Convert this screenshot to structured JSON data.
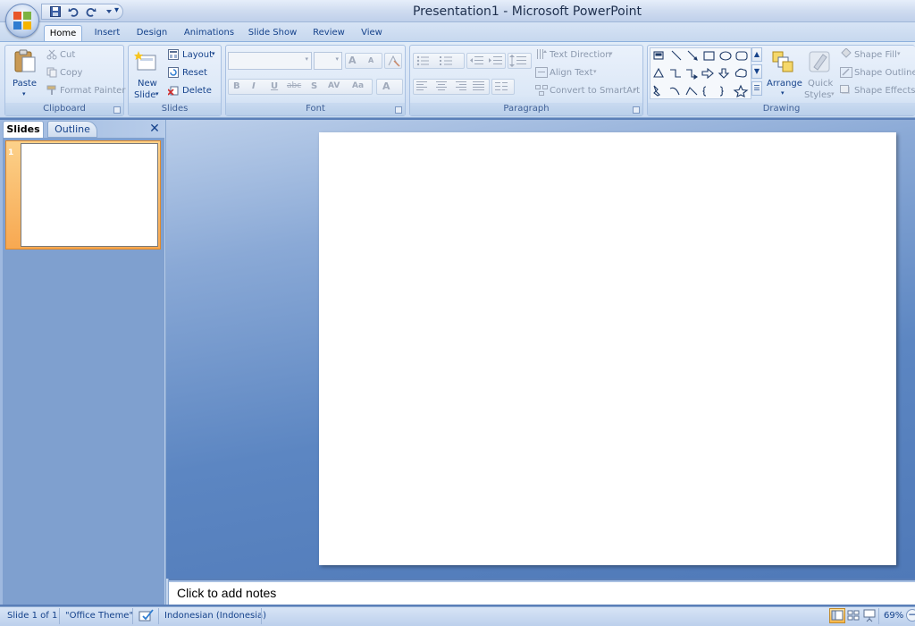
{
  "window": {
    "title": "Presentation1 - Microsoft PowerPoint"
  },
  "qat": {
    "save_icon": "save-icon",
    "undo_icon": "undo-icon",
    "redo_icon": "redo-icon",
    "customize_glyph": "▾"
  },
  "ribbon": {
    "tabs": [
      {
        "label": "Home",
        "active": true
      },
      {
        "label": "Insert"
      },
      {
        "label": "Design"
      },
      {
        "label": "Animations"
      },
      {
        "label": "Slide Show"
      },
      {
        "label": "Review"
      },
      {
        "label": "View"
      }
    ],
    "clipboard": {
      "paste": "Paste",
      "cut": "Cut",
      "copy": "Copy",
      "format_painter": "Format Painter",
      "group_label": "Clipboard"
    },
    "slides": {
      "new_slide_line1": "New",
      "new_slide_line2": "Slide",
      "layout": "Layout",
      "reset": "Reset",
      "delete": "Delete",
      "group_label": "Slides"
    },
    "font": {
      "group_label": "Font",
      "bold": "B",
      "italic": "I",
      "underline": "U",
      "strike": "abc",
      "shadow": "S",
      "spacing": "AV",
      "case": "Aa",
      "color": "A",
      "grow": "A",
      "shrink": "A"
    },
    "paragraph": {
      "group_label": "Paragraph",
      "text_direction": "Text Direction",
      "align_text": "Align Text",
      "convert_smartart": "Convert to SmartArt"
    },
    "drawing": {
      "group_label": "Drawing",
      "arrange": "Arrange",
      "quick_styles_line1": "Quick",
      "quick_styles_line2": "Styles",
      "shape_fill": "Shape Fill",
      "shape_outline": "Shape Outline",
      "shape_effects": "Shape Effects"
    }
  },
  "panel": {
    "tab_slides": "Slides",
    "tab_outline": "Outline",
    "close_glyph": "✕",
    "slide_number": "1"
  },
  "notes": {
    "placeholder": "Click to add notes"
  },
  "status": {
    "slide": "Slide 1 of 1",
    "theme": "\"Office Theme\"",
    "language": "Indonesian (Indonesia)",
    "zoom": "69%",
    "zoom_out_glyph": "−"
  },
  "colors": {
    "accent": "#f7a851",
    "ribbon_text": "#15428b"
  }
}
